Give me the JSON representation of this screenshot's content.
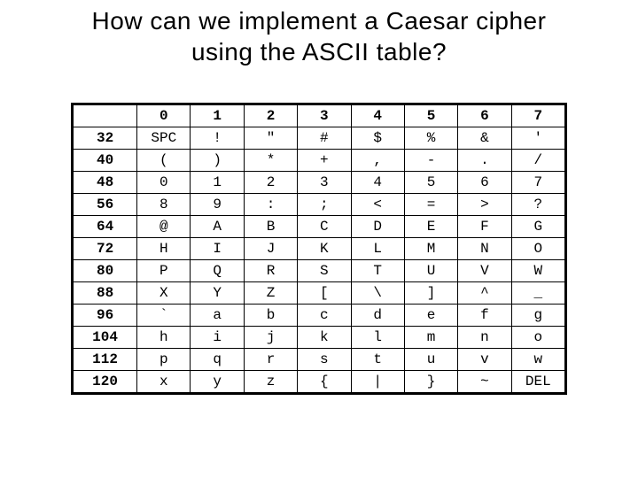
{
  "title_line1": "How can we implement a Caesar cipher",
  "title_line2": "using the ASCII table?",
  "col_headers": [
    "0",
    "1",
    "2",
    "3",
    "4",
    "5",
    "6",
    "7"
  ],
  "rows": [
    {
      "label": "32",
      "cells": [
        "SPC",
        "!",
        "\"",
        "#",
        "$",
        "%",
        "&",
        "'"
      ]
    },
    {
      "label": "40",
      "cells": [
        "(",
        ")",
        "*",
        "+",
        ",",
        "-",
        ".",
        "/"
      ]
    },
    {
      "label": "48",
      "cells": [
        "0",
        "1",
        "2",
        "3",
        "4",
        "5",
        "6",
        "7"
      ]
    },
    {
      "label": "56",
      "cells": [
        "8",
        "9",
        ":",
        ";",
        "<",
        "=",
        ">",
        "?"
      ]
    },
    {
      "label": "64",
      "cells": [
        "@",
        "A",
        "B",
        "C",
        "D",
        "E",
        "F",
        "G"
      ]
    },
    {
      "label": "72",
      "cells": [
        "H",
        "I",
        "J",
        "K",
        "L",
        "M",
        "N",
        "O"
      ]
    },
    {
      "label": "80",
      "cells": [
        "P",
        "Q",
        "R",
        "S",
        "T",
        "U",
        "V",
        "W"
      ]
    },
    {
      "label": "88",
      "cells": [
        "X",
        "Y",
        "Z",
        "[",
        "\\",
        "]",
        "^",
        "_"
      ]
    },
    {
      "label": "96",
      "cells": [
        "`",
        "a",
        "b",
        "c",
        "d",
        "e",
        "f",
        "g"
      ]
    },
    {
      "label": "104",
      "cells": [
        "h",
        "i",
        "j",
        "k",
        "l",
        "m",
        "n",
        "o"
      ]
    },
    {
      "label": "112",
      "cells": [
        "p",
        "q",
        "r",
        "s",
        "t",
        "u",
        "v",
        "w"
      ]
    },
    {
      "label": "120",
      "cells": [
        "x",
        "y",
        "z",
        "{",
        "|",
        "}",
        "~",
        "DEL"
      ]
    }
  ]
}
